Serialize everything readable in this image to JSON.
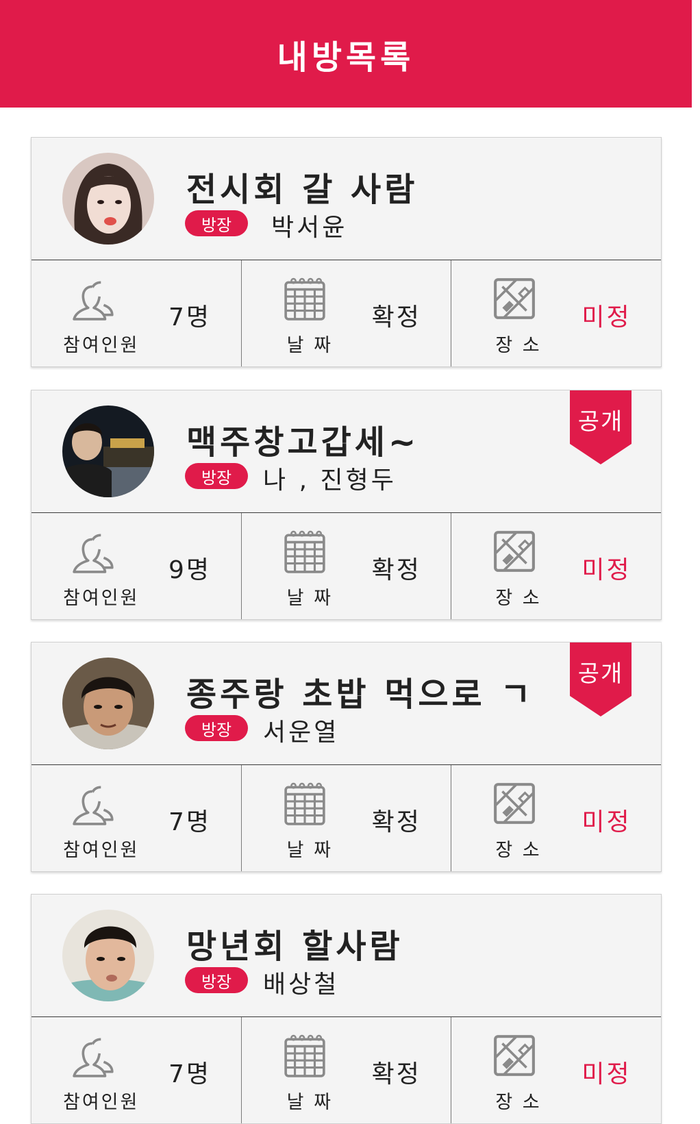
{
  "header": {
    "title": "내방목록"
  },
  "labels": {
    "host_badge": "방장",
    "public_badge": "공개",
    "participants": "참여인원",
    "date": "날 짜",
    "place": "장 소"
  },
  "colors": {
    "accent": "#e01b4a",
    "card_bg": "#f4f4f4"
  },
  "icons": {
    "participants": "people-icon",
    "date": "calendar-icon",
    "place": "map-icon"
  },
  "rooms": [
    {
      "title": "전시회 갈 사람",
      "host": "박서윤",
      "is_public": false,
      "participants": "7명",
      "date_status": "확정",
      "place_status": "미정"
    },
    {
      "title": "맥주창고갑세~",
      "host": "나 , 진형두",
      "is_public": true,
      "public_label": "공개",
      "participants": "9명",
      "date_status": "확정",
      "place_status": "미정"
    },
    {
      "title": "종주랑 초밥 먹으로 ㄱ",
      "host": "서운열",
      "is_public": true,
      "public_label": "공개",
      "participants": "7명",
      "date_status": "확정",
      "place_status": "미정"
    },
    {
      "title": "망년회 할사람",
      "host": "배상철",
      "is_public": false,
      "participants": "7명",
      "date_status": "확정",
      "place_status": "미정"
    }
  ]
}
